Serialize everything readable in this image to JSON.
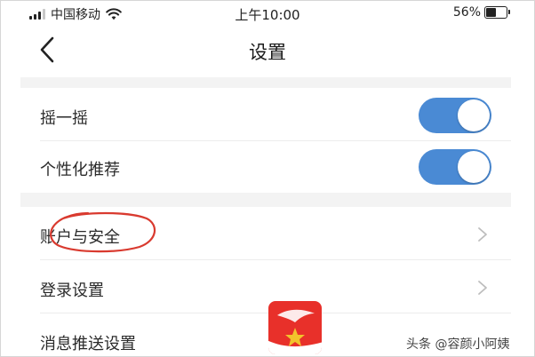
{
  "status_bar": {
    "carrier": "中国移动",
    "time": "上午10:00",
    "battery_percent": "56%",
    "battery_level": 0.56,
    "signal_bars_active": 3,
    "signal_bars_total": 4
  },
  "nav": {
    "title": "设置",
    "back_icon": "chevron-left-icon"
  },
  "settings": {
    "toggles": [
      {
        "label": "摇一摇",
        "on": true
      },
      {
        "label": "个性化推荐",
        "on": true
      }
    ],
    "links": [
      {
        "label": "账户与安全"
      },
      {
        "label": "登录设置"
      },
      {
        "label": "消息推送设置"
      }
    ]
  },
  "colors": {
    "toggle_on": "#4a8ad4",
    "section_gap": "#f3f3f3",
    "annotation": "#d93a2f",
    "watermark_logo": "#e8302a"
  },
  "watermark": {
    "text": "头条 @容颜小阿姨",
    "logo_icon": "toutiao-logo-icon"
  }
}
